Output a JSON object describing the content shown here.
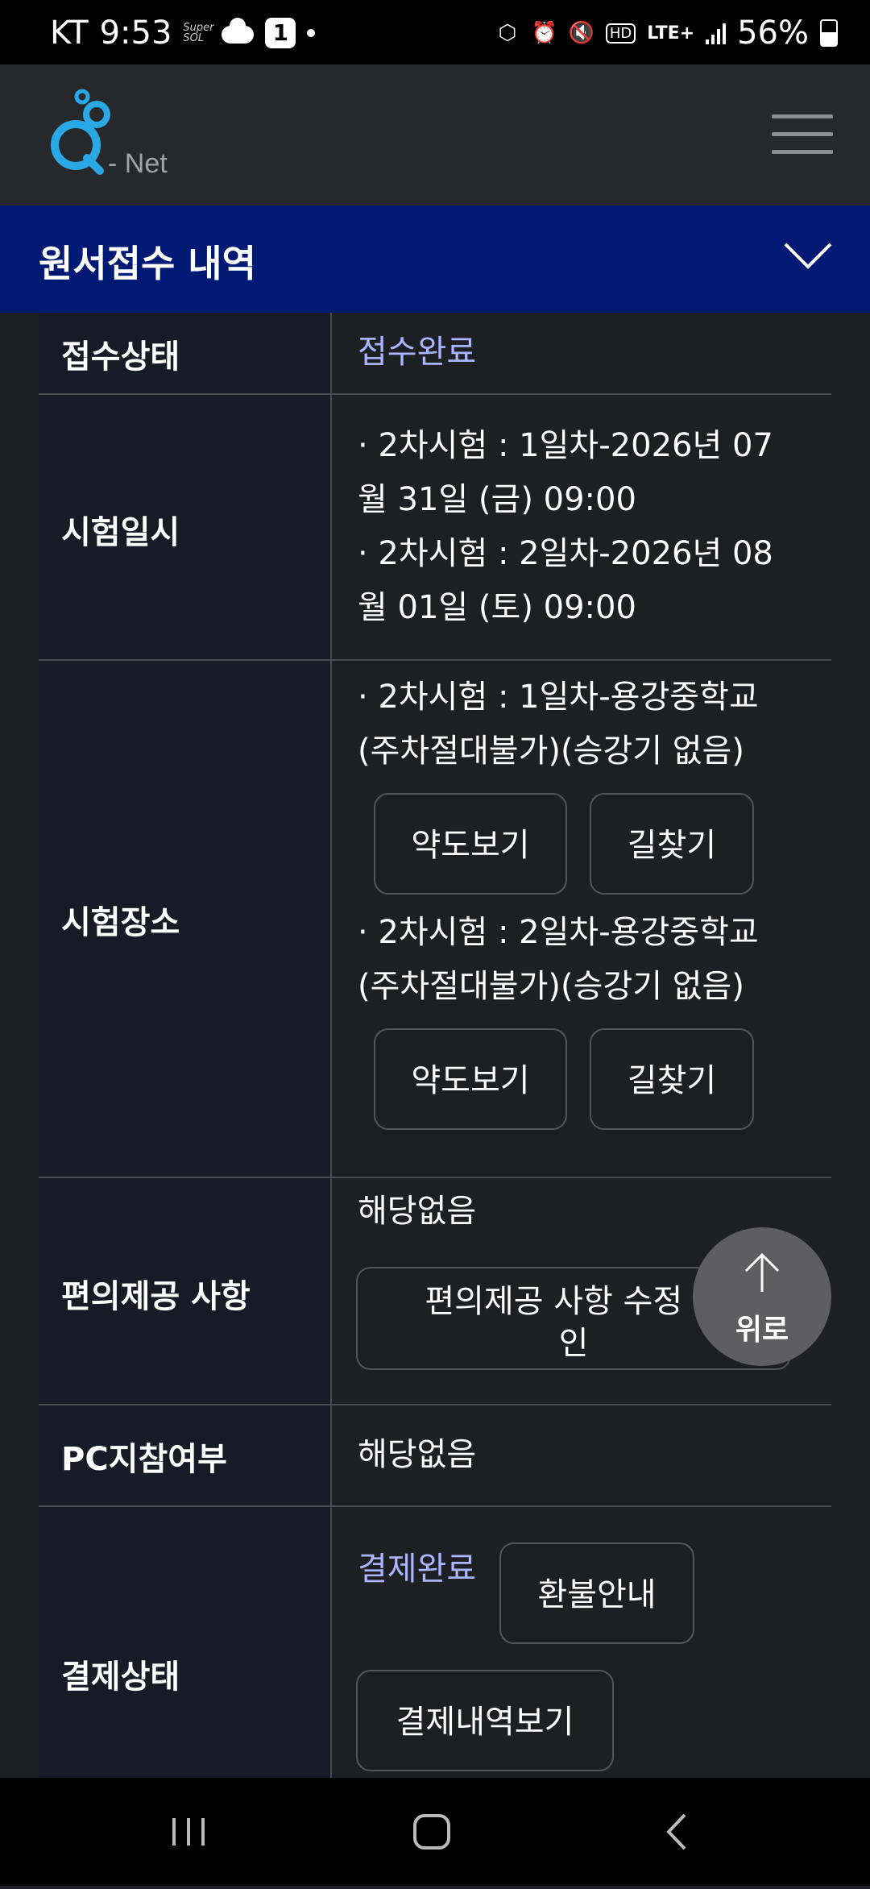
{
  "status_bar": {
    "carrier": "KT",
    "time": "9:53",
    "super_sol_label": "Super SOL",
    "notification_count": "1",
    "network": "LTE+",
    "hd_label": "HD",
    "battery": "56%"
  },
  "app": {
    "logo_text": "- Net",
    "menu_icon": "hamburger-menu-icon"
  },
  "section": {
    "title": "원서접수 내역",
    "toggle_icon": "chevron-down-icon"
  },
  "rows": {
    "status": {
      "label": "접수상태",
      "value": "접수완료"
    },
    "exam_datetime": {
      "label": "시험일시",
      "lines": [
        "· 2차시험 : 1일차-2026년 07",
        "월 31일 (금) 09:00",
        "· 2차시험 : 2일차-2026년 08",
        "월 01일 (토) 09:00"
      ]
    },
    "exam_location": {
      "label": "시험장소",
      "venue1_lines": [
        "· 2차시험 : 1일차-용강중학교",
        "(주차절대불가)(승강기 없음)"
      ],
      "venue2_lines": [
        "· 2차시험 : 2일차-용강중학교",
        "(주차절대불가)(승강기 없음)"
      ],
      "map_button": "약도보기",
      "directions_button": "길찾기"
    },
    "accommodation": {
      "label": "편의제공 사항",
      "value": "해당없음",
      "button_line1": "편의제공 사항 수정 및",
      "button_line2": "인"
    },
    "pc_guide": {
      "label": "PC지참여부",
      "value": "해당없음"
    },
    "payment": {
      "label": "결제상태",
      "value": "결제완료",
      "refund_button": "환불안내",
      "history_button": "결제내역보기"
    }
  },
  "scroll_top": {
    "label": "위로",
    "icon": "arrow-up-icon"
  },
  "colors": {
    "header_blue": "#001a73",
    "accent_text": "#aab4ff",
    "logo_blue": "#2aa8e6"
  }
}
